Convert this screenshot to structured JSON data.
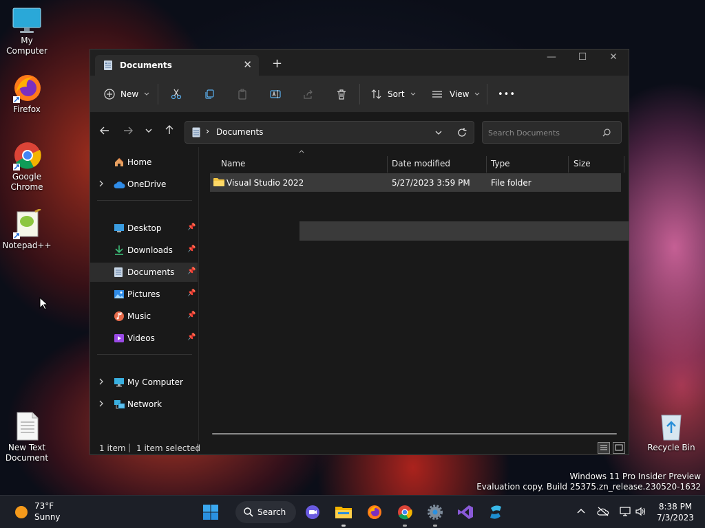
{
  "desktop": {
    "icons": [
      {
        "label": "My Computer"
      },
      {
        "label": "Firefox"
      },
      {
        "label": "Google Chrome"
      },
      {
        "label": "Notepad++"
      },
      {
        "label": "New Text Document"
      },
      {
        "label": "Recycle Bin"
      }
    ],
    "watermark": {
      "line1": "Windows 11 Pro Insider Preview",
      "line2": "Evaluation copy. Build 25375.zn_release.230520-1632"
    }
  },
  "window": {
    "tab": {
      "title": "Documents",
      "close": "✕"
    },
    "new_tab": "+",
    "controls": {
      "minimize": "—",
      "maximize": "☐",
      "close": "✕"
    },
    "toolbar": {
      "new_label": "New",
      "sort_label": "Sort",
      "view_label": "View",
      "more": "•••"
    },
    "address": {
      "separator": "›",
      "location": "Documents"
    },
    "search": {
      "placeholder": "Search Documents"
    },
    "sidebar": {
      "home": "Home",
      "onedrive": "OneDrive",
      "pinned": [
        {
          "label": "Desktop"
        },
        {
          "label": "Downloads"
        },
        {
          "label": "Documents"
        },
        {
          "label": "Pictures"
        },
        {
          "label": "Music"
        },
        {
          "label": "Videos"
        }
      ],
      "my_computer": "My Computer",
      "network": "Network"
    },
    "columns": {
      "name": "Name",
      "date": "Date modified",
      "type": "Type",
      "size": "Size"
    },
    "files": [
      {
        "name": "Visual Studio 2022",
        "date": "5/27/2023 3:59 PM",
        "type": "File folder",
        "size": ""
      }
    ],
    "status": {
      "count": "1 item",
      "selected": "1 item selected"
    }
  },
  "taskbar": {
    "weather": {
      "temp": "73°F",
      "condition": "Sunny"
    },
    "search_label": "Search",
    "clock": {
      "time": "8:38 PM",
      "date": "7/3/2023"
    }
  },
  "colors": {
    "window_bg": "#191919",
    "toolbar_bg": "#2c2c2c",
    "selection_bg": "#3a3a3a",
    "taskbar_bg": "#1c1f27",
    "folder_yellow": "#f4c542"
  }
}
